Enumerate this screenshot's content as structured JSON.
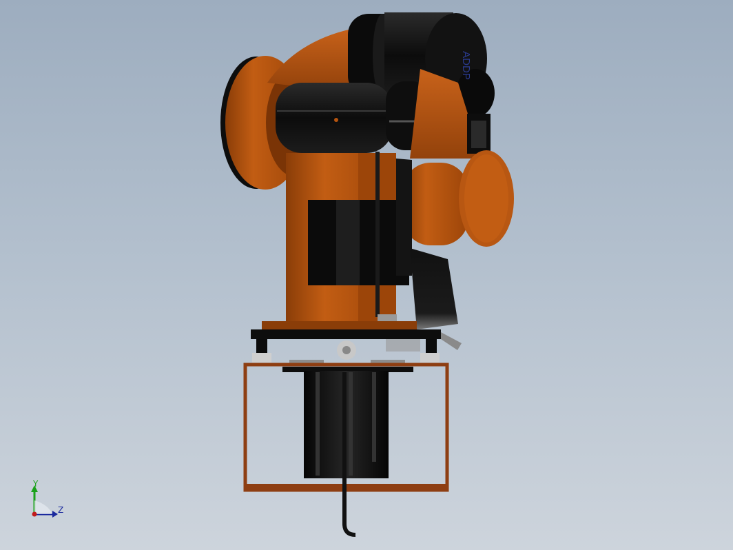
{
  "viewport": {
    "background_top": "#9dadbf",
    "background_bottom": "#cdd4dc"
  },
  "model": {
    "part_label_text": "ADDP",
    "colors": {
      "body_orange": "#b5540f",
      "body_orange_dark": "#8a3d08",
      "cover_black": "#0c0c0c",
      "cover_black_hi": "#2a2a2a",
      "frame_brown": "#8e3e12"
    }
  },
  "triad": {
    "y_label": "Y",
    "z_label": "Z",
    "y_color": "#1aa11a",
    "z_color": "#1b2a9e",
    "origin_color": "#c21b1b"
  }
}
